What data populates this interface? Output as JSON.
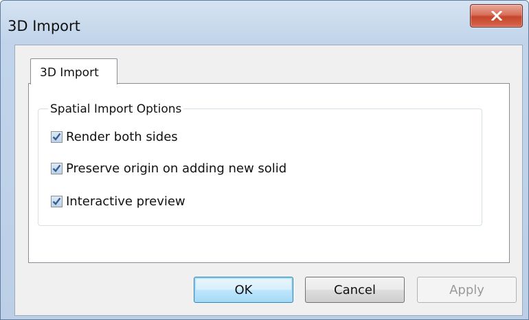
{
  "window": {
    "title": "3D Import",
    "close_icon": "close-x-icon"
  },
  "tabs": [
    {
      "label": "3D Import",
      "selected": true
    }
  ],
  "group": {
    "label": "Spatial Import Options",
    "options": [
      {
        "label": "Render both sides",
        "checked": true
      },
      {
        "label": "Preserve origin on adding new solid",
        "checked": true
      },
      {
        "label": "Interactive preview",
        "checked": true
      }
    ]
  },
  "buttons": {
    "ok": "OK",
    "cancel": "Cancel",
    "apply": "Apply",
    "apply_enabled": false
  },
  "colors": {
    "frame": "#bccfe6",
    "close_button": "#c7452b",
    "check_mark": "#3a5e8c",
    "ok_focus": "#9fdcf7"
  }
}
